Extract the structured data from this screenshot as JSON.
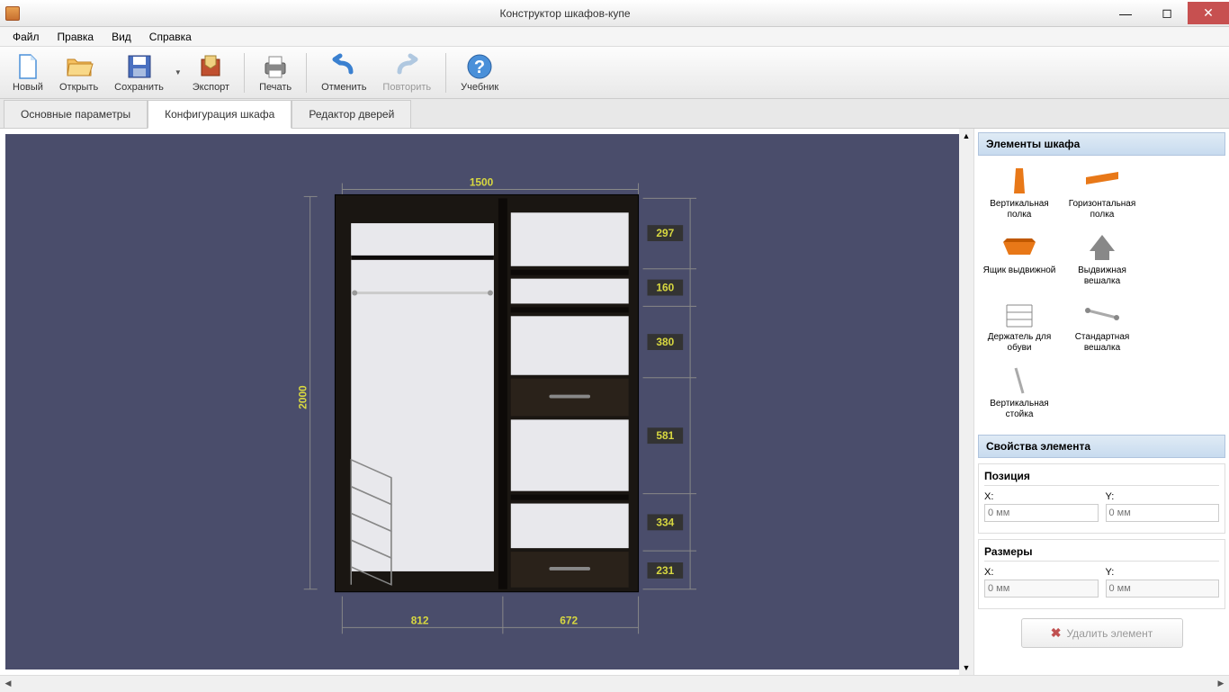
{
  "window": {
    "title": "Конструктор шкафов-купе"
  },
  "menu": {
    "file": "Файл",
    "edit": "Правка",
    "view": "Вид",
    "help": "Справка"
  },
  "toolbar": {
    "new": "Новый",
    "open": "Открыть",
    "save": "Сохранить",
    "export": "Экспорт",
    "print": "Печать",
    "undo": "Отменить",
    "redo": "Повторить",
    "tutorial": "Учебник"
  },
  "tabs": {
    "params": "Основные параметры",
    "config": "Конфигурация шкафа",
    "doors": "Редактор дверей"
  },
  "sidebar": {
    "elements_header": "Элементы шкафа",
    "items": [
      {
        "label": "Вертикальная полка"
      },
      {
        "label": "Горизонтальная полка"
      },
      {
        "label": "Ящик выдвижной"
      },
      {
        "label": "Выдвижная вешалка"
      },
      {
        "label": "Держатель для обуви"
      },
      {
        "label": "Стандартная вешалка"
      },
      {
        "label": "Вертикальная стойка"
      }
    ],
    "props_header": "Свойства элемента",
    "position": "Позиция",
    "dimensions": "Размеры",
    "x_label": "X:",
    "y_label": "Y:",
    "placeholder": "0 мм",
    "delete": "Удалить элемент"
  },
  "cabinet": {
    "width": "1500",
    "height": "2000",
    "section_left_w": "812",
    "section_right_w": "672",
    "shelves_right": [
      "297",
      "160",
      "380",
      "581",
      "334",
      "231"
    ]
  }
}
